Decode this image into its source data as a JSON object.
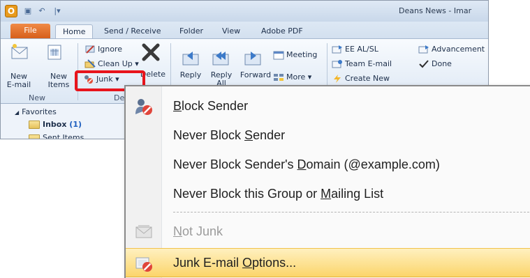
{
  "window": {
    "title": "Deans News - Imar",
    "logo_letter": "O",
    "qat_icons": [
      "save-icon",
      "undo-icon",
      "customize-icon"
    ],
    "qat_glyphs": [
      "▣",
      "↶",
      "|▾"
    ]
  },
  "tabs": [
    {
      "id": "file",
      "label": "File"
    },
    {
      "id": "home",
      "label": "Home"
    },
    {
      "id": "send_receive",
      "label": "Send / Receive"
    },
    {
      "id": "folder",
      "label": "Folder"
    },
    {
      "id": "view",
      "label": "View"
    },
    {
      "id": "adobe_pdf",
      "label": "Adobe PDF"
    }
  ],
  "ribbon": {
    "new_email": "New\nE-mail",
    "new_items": "New\nItems",
    "new_group": "New",
    "ignore": "Ignore",
    "clean_up": "Clean Up",
    "junk": "Junk",
    "delete": "Delete",
    "delete_group": "De",
    "reply": "Reply",
    "reply_all": "Reply\nAll",
    "forward": "Forward",
    "meeting": "Meeting",
    "more": "More",
    "quick_steps": [
      "EE AL/SL",
      "Team E-mail",
      "Create New"
    ],
    "quick_steps_right": [
      "Advancement",
      "Done"
    ],
    "dropdown_arrow": "▾"
  },
  "nav": {
    "favorites": "Favorites",
    "inbox": "Inbox",
    "inbox_count": "(1)",
    "sent": "Sent Items",
    "collapse_glyph": "◢"
  },
  "menu": {
    "items": [
      {
        "id": "block_sender",
        "pre": "",
        "accel": "B",
        "post": "lock Sender",
        "disabled": false,
        "icon": "block-sender-icon"
      },
      {
        "id": "never_block_sender",
        "pre": "Never Block ",
        "accel": "S",
        "post": "ender",
        "disabled": false,
        "icon": ""
      },
      {
        "id": "never_block_domain",
        "pre": "Never Block Sender's ",
        "accel": "D",
        "post": "omain (@example.com)",
        "disabled": false,
        "icon": ""
      },
      {
        "id": "never_block_group",
        "pre": "Never Block this Group or ",
        "accel": "M",
        "post": "ailing List",
        "disabled": false,
        "icon": ""
      },
      {
        "id": "not_junk",
        "pre": "",
        "accel": "N",
        "post": "ot Junk",
        "disabled": true,
        "icon": "not-junk-icon"
      },
      {
        "id": "junk_options",
        "pre": "Junk E-mail ",
        "accel": "O",
        "post": "ptions...",
        "disabled": false,
        "icon": "junk-options-icon"
      }
    ]
  },
  "colors": {
    "highlight_border": "#e8141c",
    "file_tab": "#d65f1a",
    "menu_hover": "#fbd56b"
  }
}
